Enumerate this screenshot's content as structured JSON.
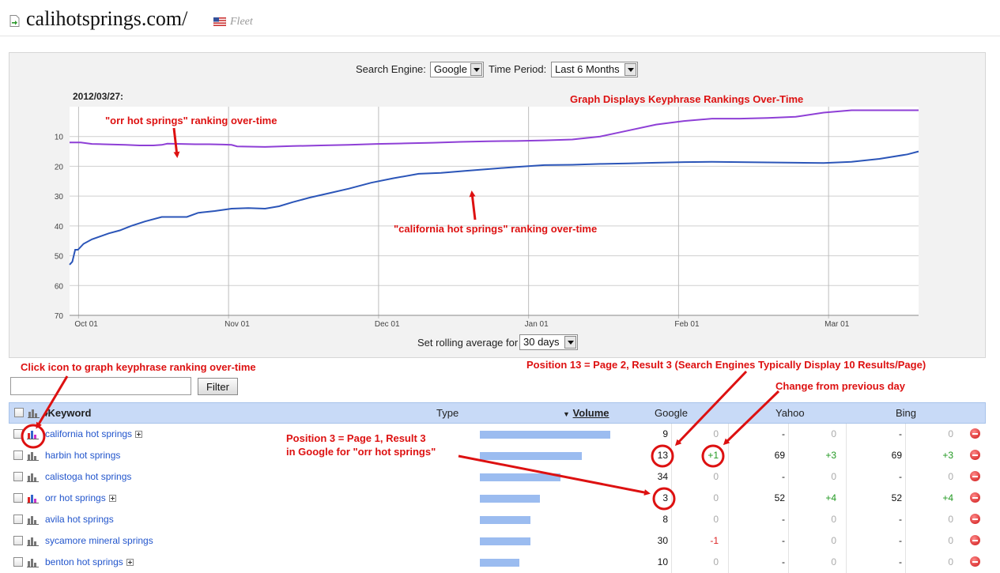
{
  "header": {
    "site": "calihotsprings.com/",
    "flag_icon": "us-flag-icon",
    "fleet": "Fleet"
  },
  "controls": {
    "search_engine_label": "Search Engine:",
    "search_engine_value": "Google",
    "time_period_label": "Time Period:",
    "time_period_value": "Last 6 Months",
    "rolling_label": "Set rolling average for",
    "rolling_value": "30 days"
  },
  "graph": {
    "date": "2012/03/27:"
  },
  "chart_data": {
    "type": "line",
    "x_ticks": [
      "Oct 01",
      "Nov 01",
      "Dec 01",
      "Jan 01",
      "Feb 01",
      "Mar 01"
    ],
    "y_ticks": [
      10,
      20,
      30,
      40,
      50,
      60,
      70
    ],
    "ylim": [
      70,
      0
    ],
    "y_inverted": true,
    "grid": true,
    "series": [
      {
        "color": "#8e3fd6",
        "points": [
          [
            0,
            11
          ],
          [
            0.04,
            11
          ],
          [
            0.08,
            11.5
          ],
          [
            0.12,
            11.6
          ],
          [
            0.16,
            11.7
          ],
          [
            0.2,
            11.8
          ],
          [
            0.25,
            12
          ],
          [
            0.3,
            12
          ],
          [
            0.33,
            11.8
          ],
          [
            0.35,
            11.4
          ],
          [
            0.4,
            11.5
          ],
          [
            0.45,
            11.6
          ],
          [
            0.5,
            11.6
          ],
          [
            0.55,
            11.7
          ],
          [
            0.58,
            11.8
          ],
          [
            0.6,
            12.3
          ],
          [
            0.7,
            12.5
          ],
          [
            0.8,
            12.2
          ],
          [
            0.9,
            12
          ],
          [
            1.0,
            11.8
          ],
          [
            1.1,
            11.5
          ],
          [
            1.2,
            11.3
          ],
          [
            1.3,
            11.1
          ],
          [
            1.4,
            10.8
          ],
          [
            1.5,
            10.6
          ],
          [
            1.6,
            10.5
          ],
          [
            1.7,
            10.3
          ],
          [
            1.8,
            10
          ],
          [
            1.9,
            9
          ],
          [
            2.0,
            7
          ],
          [
            2.1,
            5
          ],
          [
            2.2,
            3.8
          ],
          [
            2.3,
            3
          ],
          [
            2.4,
            3
          ],
          [
            2.5,
            2.8
          ],
          [
            2.6,
            2.4
          ],
          [
            2.7,
            1
          ],
          [
            2.8,
            0.2
          ],
          [
            2.9,
            0.2
          ],
          [
            3.0,
            0.2
          ],
          [
            3.04,
            0.2
          ]
        ]
      },
      {
        "color": "#2b55b8",
        "points": [
          [
            0,
            52
          ],
          [
            0.01,
            51
          ],
          [
            0.02,
            47
          ],
          [
            0.03,
            47
          ],
          [
            0.05,
            45
          ],
          [
            0.08,
            43.5
          ],
          [
            0.11,
            42.5
          ],
          [
            0.14,
            41.5
          ],
          [
            0.18,
            40.5
          ],
          [
            0.22,
            39
          ],
          [
            0.27,
            37.5
          ],
          [
            0.33,
            36
          ],
          [
            0.38,
            36
          ],
          [
            0.42,
            36
          ],
          [
            0.46,
            34.6
          ],
          [
            0.52,
            34
          ],
          [
            0.58,
            33.2
          ],
          [
            0.64,
            33
          ],
          [
            0.7,
            33.2
          ],
          [
            0.75,
            32.4
          ],
          [
            0.8,
            31
          ],
          [
            0.86,
            29.5
          ],
          [
            0.93,
            28
          ],
          [
            1.0,
            26.5
          ],
          [
            1.08,
            24.5
          ],
          [
            1.16,
            23
          ],
          [
            1.25,
            21.5
          ],
          [
            1.33,
            21.2
          ],
          [
            1.42,
            20.5
          ],
          [
            1.52,
            19.8
          ],
          [
            1.6,
            19.2
          ],
          [
            1.7,
            18.6
          ],
          [
            1.8,
            18.5
          ],
          [
            1.9,
            18.2
          ],
          [
            2.0,
            18
          ],
          [
            2.1,
            17.8
          ],
          [
            2.2,
            17.6
          ],
          [
            2.3,
            17.5
          ],
          [
            2.4,
            17.6
          ],
          [
            2.5,
            17.7
          ],
          [
            2.6,
            17.8
          ],
          [
            2.7,
            17.9
          ],
          [
            2.8,
            17.5
          ],
          [
            2.9,
            16.5
          ],
          [
            3.0,
            15
          ],
          [
            3.04,
            14
          ]
        ]
      }
    ]
  },
  "annotations": {
    "title": "Graph Displays Keyphrase Rankings Over-Time",
    "orr": "\"orr hot springs\" ranking over-time",
    "california": "\"california hot springs\" ranking over-time",
    "click_icon": "Click icon to graph keyphrase ranking over-time",
    "pos13": "Position 13 = Page 2, Result 3 (Search Engines Typically Display 10 Results/Page)",
    "change": "Change from previous day",
    "pos3_line1": "Position 3 = Page 1, Result 3",
    "pos3_line2": "in Google for \"orr hot springs\""
  },
  "filter": {
    "button": "Filter",
    "placeholder": ""
  },
  "table": {
    "headers": {
      "keyword": "Keyword",
      "type": "Type",
      "volume": "Volume",
      "google": "Google",
      "yahoo": "Yahoo",
      "bing": "Bing"
    },
    "rows": [
      {
        "keyword": "california hot springs",
        "expand": true,
        "icon_color": true,
        "volume": 1.0,
        "google": "9",
        "google_chg": "0",
        "yahoo": "-",
        "yahoo_chg": "0",
        "bing": "-",
        "bing_chg": "0"
      },
      {
        "keyword": "harbin hot springs",
        "expand": false,
        "icon_color": false,
        "volume": 0.78,
        "google": "13",
        "google_chg": "+1",
        "yahoo": "69",
        "yahoo_chg": "+3",
        "bing": "69",
        "bing_chg": "+3"
      },
      {
        "keyword": "calistoga hot springs",
        "expand": false,
        "icon_color": false,
        "volume": 0.62,
        "google": "34",
        "google_chg": "0",
        "yahoo": "-",
        "yahoo_chg": "0",
        "bing": "-",
        "bing_chg": "0"
      },
      {
        "keyword": "orr hot springs",
        "expand": true,
        "icon_color": true,
        "volume": 0.46,
        "google": "3",
        "google_chg": "0",
        "yahoo": "52",
        "yahoo_chg": "+4",
        "bing": "52",
        "bing_chg": "+4"
      },
      {
        "keyword": "avila hot springs",
        "expand": false,
        "icon_color": false,
        "volume": 0.39,
        "google": "8",
        "google_chg": "0",
        "yahoo": "-",
        "yahoo_chg": "0",
        "bing": "-",
        "bing_chg": "0"
      },
      {
        "keyword": "sycamore mineral springs",
        "expand": false,
        "icon_color": false,
        "volume": 0.39,
        "google": "30",
        "google_chg": "-1",
        "yahoo": "-",
        "yahoo_chg": "0",
        "bing": "-",
        "bing_chg": "0"
      },
      {
        "keyword": "benton hot springs",
        "expand": true,
        "icon_color": false,
        "volume": 0.3,
        "google": "10",
        "google_chg": "0",
        "yahoo": "-",
        "yahoo_chg": "0",
        "bing": "-",
        "bing_chg": "0"
      }
    ]
  }
}
